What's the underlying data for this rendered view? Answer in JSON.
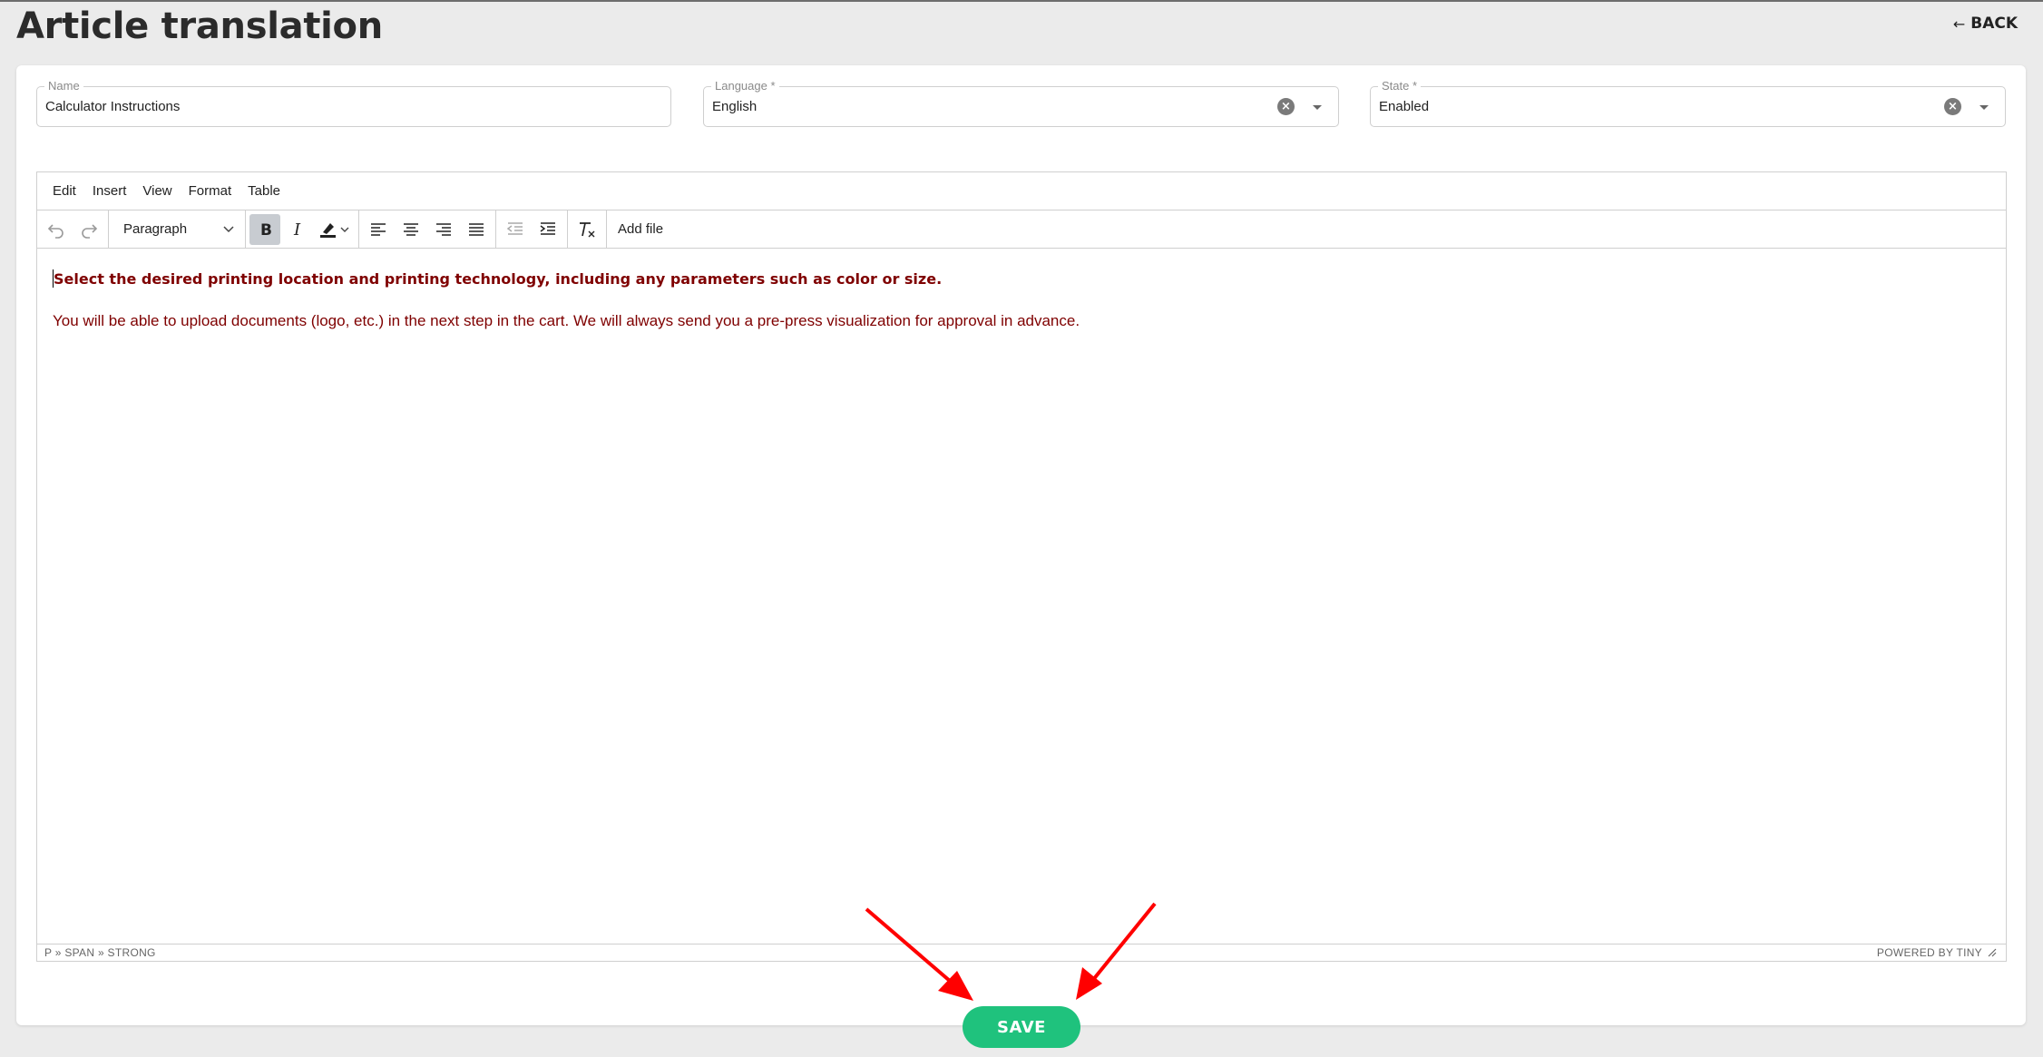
{
  "page": {
    "title": "Article translation",
    "back_label": "BACK"
  },
  "form": {
    "name": {
      "label": "Name",
      "value": "Calculator Instructions"
    },
    "language": {
      "label": "Language *",
      "value": "English"
    },
    "state": {
      "label": "State *",
      "value": "Enabled"
    }
  },
  "editor": {
    "menu": [
      "Edit",
      "Insert",
      "View",
      "Format",
      "Table"
    ],
    "block_format": "Paragraph",
    "add_file_label": "Add file",
    "toolbar_icons": [
      "undo-icon",
      "redo-icon",
      "bold-icon",
      "italic-icon",
      "highlight-color-icon",
      "align-left-icon",
      "align-center-icon",
      "align-right-icon",
      "justify-icon",
      "outdent-icon",
      "indent-icon",
      "clear-formatting-icon"
    ],
    "content": {
      "line1": "Select the desired printing location and printing technology, including any parameters such as color or size.",
      "line2": "You will be able to upload documents (logo, etc.) in the next step in the cart. We will always send you a pre-press visualization for approval in advance."
    },
    "text_color": "#7f0000",
    "status_path": "P » SPAN » STRONG",
    "powered_by": "POWERED BY TINY"
  },
  "actions": {
    "save_label": "SAVE",
    "save_color": "#1fc27d"
  },
  "annotation": {
    "arrow_color": "#ff0000"
  }
}
